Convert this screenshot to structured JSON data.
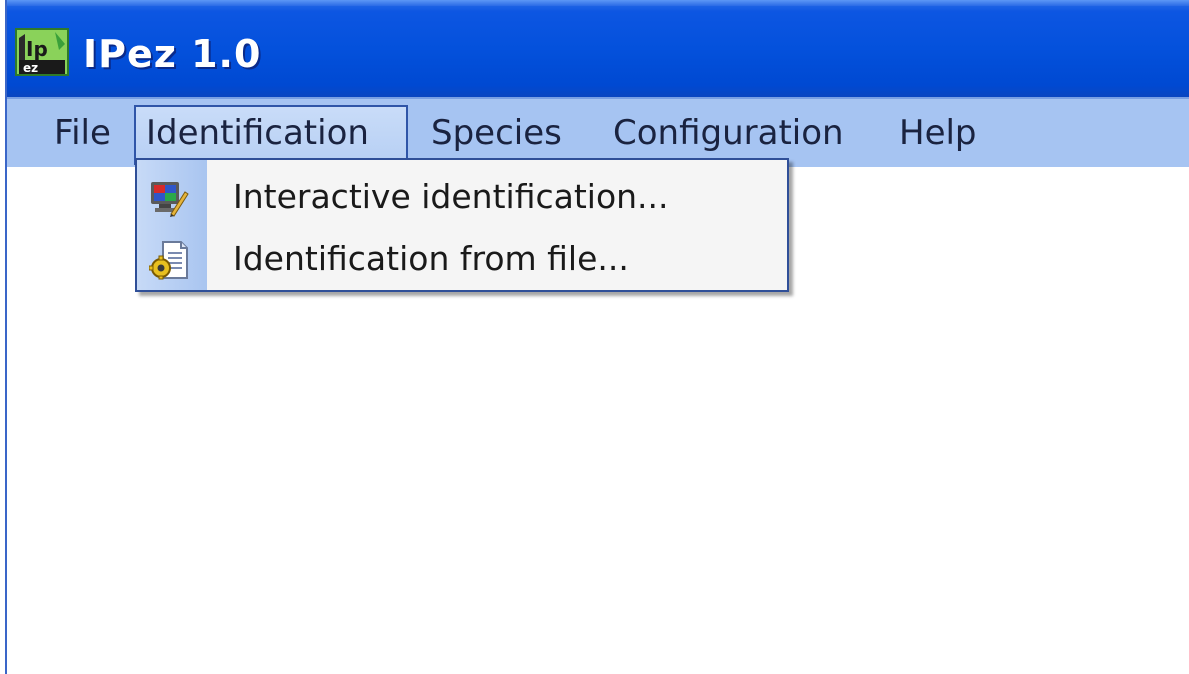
{
  "window": {
    "title": "IPez 1.0",
    "icon": "ipez-app-icon"
  },
  "menubar": {
    "items": [
      {
        "label": "File"
      },
      {
        "label": "Identification"
      },
      {
        "label": "Species"
      },
      {
        "label": "Configuration"
      },
      {
        "label": "Help"
      }
    ],
    "active": "Identification"
  },
  "dropdown": {
    "items": [
      {
        "label": "Interactive identification...",
        "icon": "interactive-identification-icon"
      },
      {
        "label": "Identification from file...",
        "icon": "file-gear-icon"
      }
    ]
  },
  "colors": {
    "titlebar": "#0451dc",
    "menubar": "#a6c4f2",
    "dropdown_border": "#2f4f98",
    "dropdown_bg": "#f5f5f5"
  }
}
